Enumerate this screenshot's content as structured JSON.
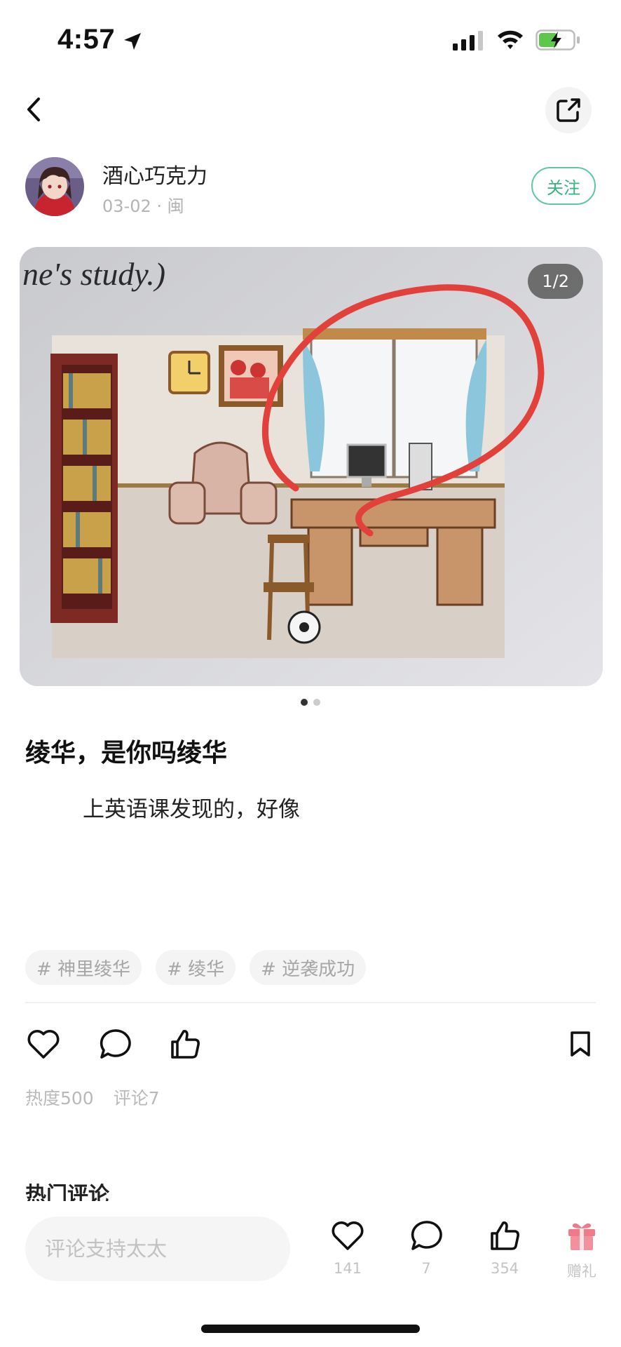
{
  "status_bar": {
    "time": "4:57"
  },
  "author": {
    "name": "酒心巧克力",
    "meta": "03-02 · 闽",
    "follow_label": "关注"
  },
  "image": {
    "counter": "1/2",
    "caption_text": "ne's study.)"
  },
  "post": {
    "title": "绫华，是你吗绫华",
    "body": "上英语课发现的，好像"
  },
  "tags": [
    "# 神里绫华",
    "# 绫华",
    "# 逆袭成功"
  ],
  "stats": {
    "heat": "热度500",
    "comments": "评论7"
  },
  "hot_comments_title": "热门评论",
  "bottom_bar": {
    "input_placeholder": "评论支持太太",
    "like_count": "141",
    "comment_count": "7",
    "thumb_count": "354",
    "gift_label": "赠礼"
  },
  "colors": {
    "accent": "#34b37f",
    "gift": "#f07a8a",
    "circle": "#e2413b"
  }
}
